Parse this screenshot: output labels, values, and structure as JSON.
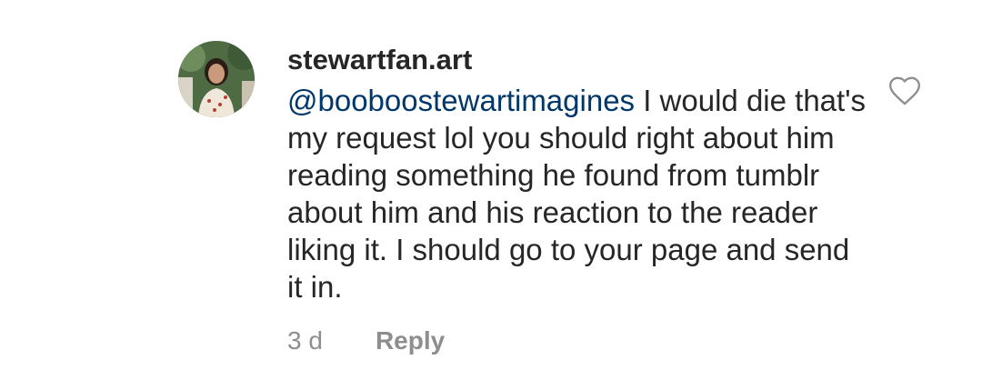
{
  "comment": {
    "username": "stewartfan.art",
    "mention": "@booboostewartimagines",
    "text": " I would die that's my request lol you should right about him reading something he found from tumblr about him and his reaction to the reader liking it. I should go to your page and send it in.",
    "time": "3 d",
    "reply_label": "Reply",
    "like_icon": "heart-outline-icon"
  }
}
